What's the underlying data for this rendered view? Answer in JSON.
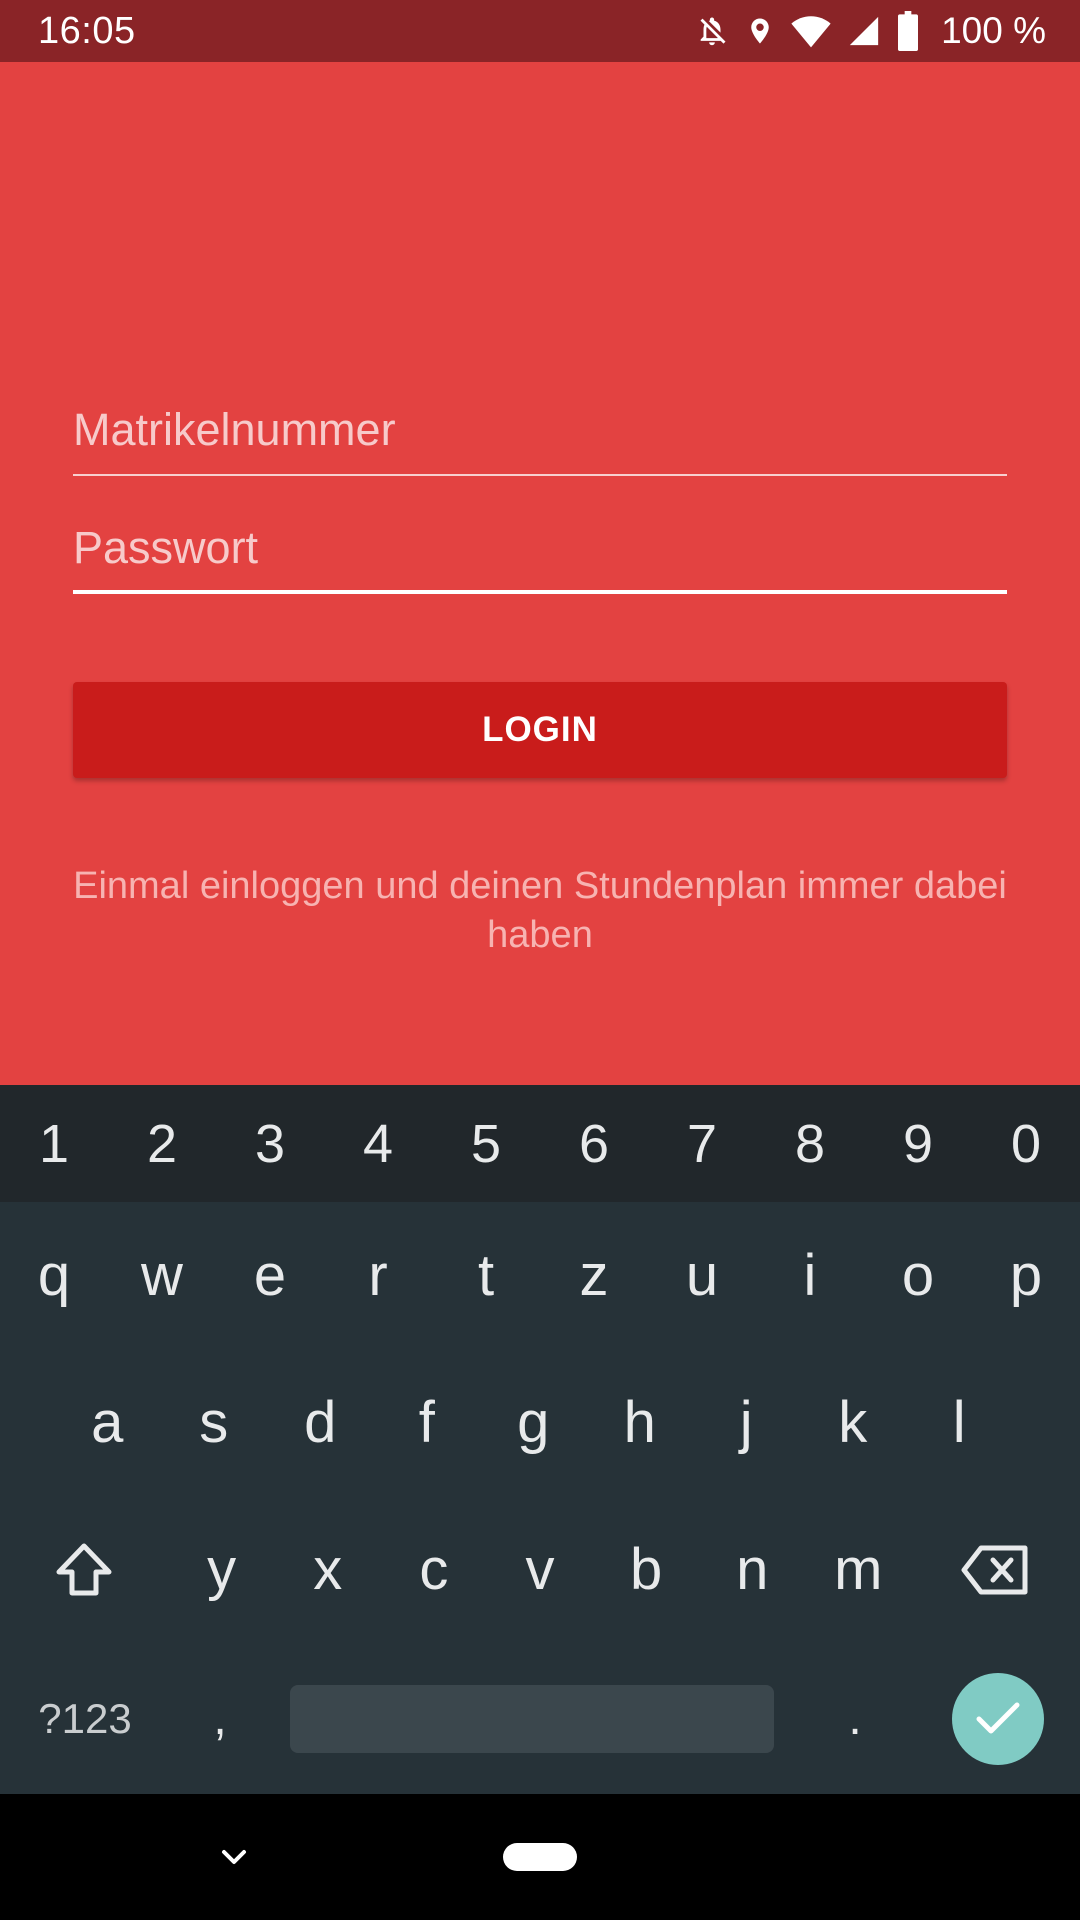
{
  "status_bar": {
    "time": "16:05",
    "battery": "100 %",
    "icons": [
      "notifications-off-icon",
      "location-icon",
      "wifi-icon",
      "cell-signal-icon",
      "battery-icon"
    ]
  },
  "login": {
    "username_placeholder": "Matrikelnummer",
    "password_placeholder": "Passwort",
    "button_label": "LOGIN",
    "hint": "Einmal einloggen und deinen Stundenplan immer dabei haben"
  },
  "keyboard": {
    "numbers": [
      "1",
      "2",
      "3",
      "4",
      "5",
      "6",
      "7",
      "8",
      "9",
      "0"
    ],
    "row1": [
      "q",
      "w",
      "e",
      "r",
      "t",
      "z",
      "u",
      "i",
      "o",
      "p"
    ],
    "row2": [
      "a",
      "s",
      "d",
      "f",
      "g",
      "h",
      "j",
      "k",
      "l"
    ],
    "row3": [
      "y",
      "x",
      "c",
      "v",
      "b",
      "n",
      "m"
    ],
    "symbols_label": "?123",
    "comma": ",",
    "period": "."
  },
  "colors": {
    "status_bar": "#8a2427",
    "background": "#e34241",
    "button": "#c91c1b",
    "keyboard": "#263238",
    "enter": "#80cbc4"
  }
}
